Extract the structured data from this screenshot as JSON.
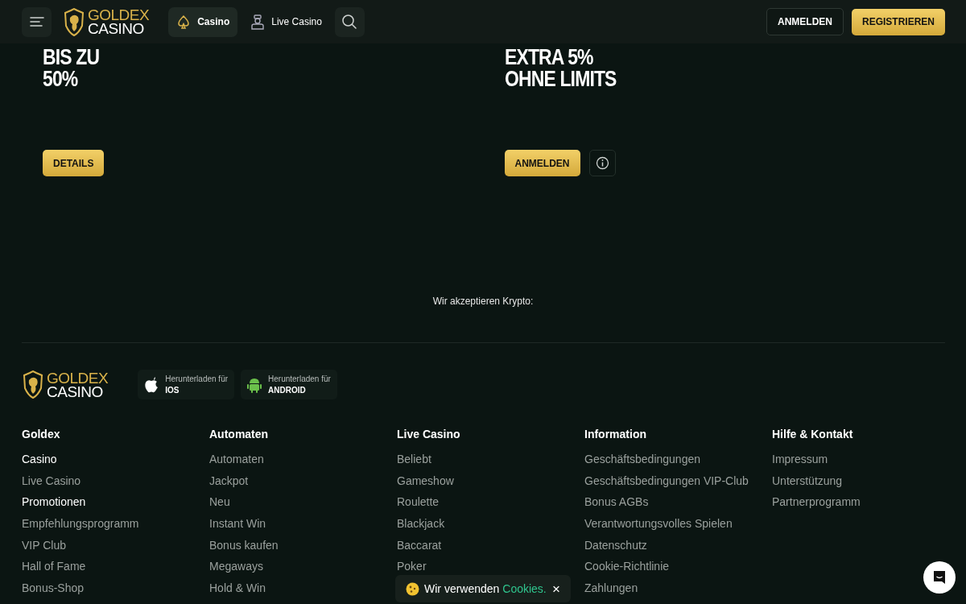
{
  "header": {
    "logo": {
      "line1": "GOLDEX",
      "line2": "CASINO"
    },
    "nav": [
      {
        "label": "Casino",
        "selected": true
      },
      {
        "label": "Live Casino",
        "selected": false
      }
    ],
    "login": "ANMELDEN",
    "register": "REGISTRIEREN"
  },
  "promos": [
    {
      "title_lines": [
        "BIS ZU",
        "50%"
      ],
      "button": "DETAILS",
      "info": false
    },
    {
      "title_lines": [
        "EXTRA 5%",
        "OHNE LIMITS"
      ],
      "button": "ANMELDEN",
      "info": true
    }
  ],
  "crypto_label": "Wir akzeptieren Krypto:",
  "footer": {
    "logo": {
      "line1": "GOLDEX",
      "line2": "CASINO"
    },
    "apps": [
      {
        "kind": "apple",
        "caption": "Herunterladen für",
        "name": "IOS"
      },
      {
        "kind": "robot",
        "caption": "Herunterladen für",
        "name": "ANDROID"
      }
    ],
    "columns": [
      {
        "heading": "Goldex",
        "links": [
          {
            "label": "Casino",
            "highlighted": true
          },
          {
            "label": "Live Casino",
            "highlighted": false
          },
          {
            "label": "Promotionen",
            "highlighted": true
          },
          {
            "label": "Empfehlungsprogramm",
            "highlighted": false
          },
          {
            "label": "VIP Club",
            "highlighted": false
          },
          {
            "label": "Hall of Fame",
            "highlighted": false
          },
          {
            "label": "Bonus-Shop",
            "highlighted": false
          }
        ]
      },
      {
        "heading": "Automaten",
        "links": [
          {
            "label": "Automaten",
            "highlighted": false
          },
          {
            "label": "Jackpot",
            "highlighted": false
          },
          {
            "label": "Neu",
            "highlighted": false
          },
          {
            "label": "Instant Win",
            "highlighted": false
          },
          {
            "label": "Bonus kaufen",
            "highlighted": false
          },
          {
            "label": "Megaways",
            "highlighted": false
          },
          {
            "label": "Hold & Win",
            "highlighted": false
          }
        ]
      },
      {
        "heading": "Live Casino",
        "links": [
          {
            "label": "Beliebt",
            "highlighted": false
          },
          {
            "label": "Gameshow",
            "highlighted": false
          },
          {
            "label": "Roulette",
            "highlighted": false
          },
          {
            "label": "Blackjack",
            "highlighted": false
          },
          {
            "label": "Baccarat",
            "highlighted": false
          },
          {
            "label": "Poker",
            "highlighted": false
          }
        ]
      },
      {
        "heading": "Information",
        "links": [
          {
            "label": "Geschäftsbedingungen",
            "highlighted": false
          },
          {
            "label": "Geschäftsbedingungen VIP-Club",
            "highlighted": false
          },
          {
            "label": "Bonus AGBs",
            "highlighted": false
          },
          {
            "label": "Verantwortungsvolles Spielen",
            "highlighted": false
          },
          {
            "label": "Datenschutz",
            "highlighted": false
          },
          {
            "label": "Cookie-Richtlinie",
            "highlighted": false
          },
          {
            "label": "Zahlungen",
            "highlighted": false
          }
        ]
      },
      {
        "heading": "Hilfe & Kontakt",
        "links": [
          {
            "label": "Impressum",
            "highlighted": false
          },
          {
            "label": "Unterstützung",
            "highlighted": false
          },
          {
            "label": "Partnerprogramm",
            "highlighted": false
          }
        ]
      }
    ]
  },
  "cookie_banner": {
    "text": "Wir verwenden",
    "link": "Cookies.",
    "close": "×"
  }
}
